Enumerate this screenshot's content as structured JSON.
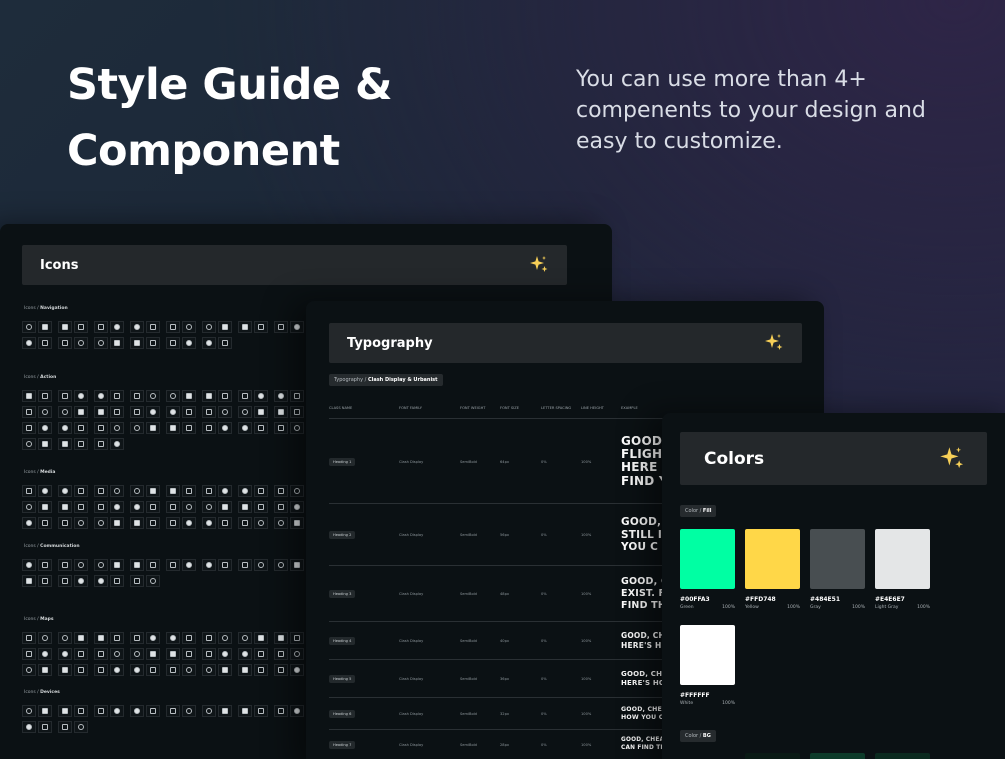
{
  "hero": {
    "title_line1": "Style Guide &",
    "title_line2": "Component",
    "subtitle": "You can use more than 4+ compenents to your design and easy to customize."
  },
  "icons_panel": {
    "title": "Icons",
    "sparkle_icon": "sparkles-icon",
    "sections": [
      {
        "prefix": "Icons / ",
        "name": "Navigation"
      },
      {
        "prefix": "Icons / ",
        "name": "Action"
      },
      {
        "prefix": "Icons / ",
        "name": "Media"
      },
      {
        "prefix": "Icons / ",
        "name": "Communication"
      },
      {
        "prefix": "Icons / ",
        "name": "Maps"
      },
      {
        "prefix": "Icons / ",
        "name": "Devices"
      }
    ]
  },
  "typography_panel": {
    "title": "Typography",
    "tag_prefix": "Typography / ",
    "tag_name": "Clash Display & Urbanist",
    "columns": [
      "CLASS NAME",
      "FONT FAMILY",
      "FONT WEIGHT",
      "FONT SIZE",
      "LETTER SPACING",
      "LINE HEIGHT",
      "EXAMPLE"
    ],
    "rows": [
      {
        "class": "Heading 1",
        "family": "Clash Display",
        "weight": "SemiBold",
        "size": "64px",
        "spacing": "0%",
        "line": "100%",
        "example": [
          "GOOD",
          "FLIGH",
          "HERE",
          "FIND Y"
        ]
      },
      {
        "class": "Heading 2",
        "family": "Clash Display",
        "weight": "SemiBold",
        "size": "56px",
        "spacing": "0%",
        "line": "100%",
        "example": [
          "GOOD,",
          "STILL I",
          "YOU C"
        ]
      },
      {
        "class": "Heading 3",
        "family": "Clash Display",
        "weight": "SemiBold",
        "size": "48px",
        "spacing": "0%",
        "line": "100%",
        "example": [
          "GOOD, C",
          "EXIST. F",
          "FIND TH"
        ]
      },
      {
        "class": "Heading 4",
        "family": "Clash Display",
        "weight": "SemiBold",
        "size": "40px",
        "spacing": "0%",
        "line": "100%",
        "example": [
          "GOOD, CH",
          "HERE'S H"
        ]
      },
      {
        "class": "Heading 5",
        "family": "Clash Display",
        "weight": "SemiBold",
        "size": "36px",
        "spacing": "0%",
        "line": "100%",
        "example": [
          "GOOD, CHE",
          "HERE'S HO"
        ]
      },
      {
        "class": "Heading 6",
        "family": "Clash Display",
        "weight": "SemiBold",
        "size": "32px",
        "spacing": "0%",
        "line": "100%",
        "example": [
          "GOOD, CHEA",
          "HOW YOU C"
        ]
      },
      {
        "class": "Heading 7",
        "family": "Clash Display",
        "weight": "SemiBold",
        "size": "28px",
        "spacing": "0%",
        "line": "100%",
        "example": [
          "GOOD, CHEA",
          "CAN FIND TH"
        ]
      }
    ]
  },
  "colors_panel": {
    "title": "Colors",
    "fill_tag_prefix": "Color / ",
    "fill_tag_name": "Fill",
    "bg_tag_prefix": "Color / ",
    "bg_tag_name": "BG",
    "swatches": [
      {
        "hex": "#00FFA3",
        "name": "Green",
        "opacity": "100%",
        "color": "#00ffa3"
      },
      {
        "hex": "#FFD748",
        "name": "Yellow",
        "opacity": "100%",
        "color": "#ffd748"
      },
      {
        "hex": "#484E51",
        "name": "Gray",
        "opacity": "100%",
        "color": "#484e51"
      },
      {
        "hex": "#E4E6E7",
        "name": "Light Gray",
        "opacity": "100%",
        "color": "#e4e6e7"
      },
      {
        "hex": "#FFFFFF",
        "name": "White",
        "opacity": "100%",
        "color": "#ffffff"
      }
    ],
    "bg_swatch_colors": [
      "#0a1a15",
      "#0d3b2a",
      "#0b2a1f"
    ]
  }
}
